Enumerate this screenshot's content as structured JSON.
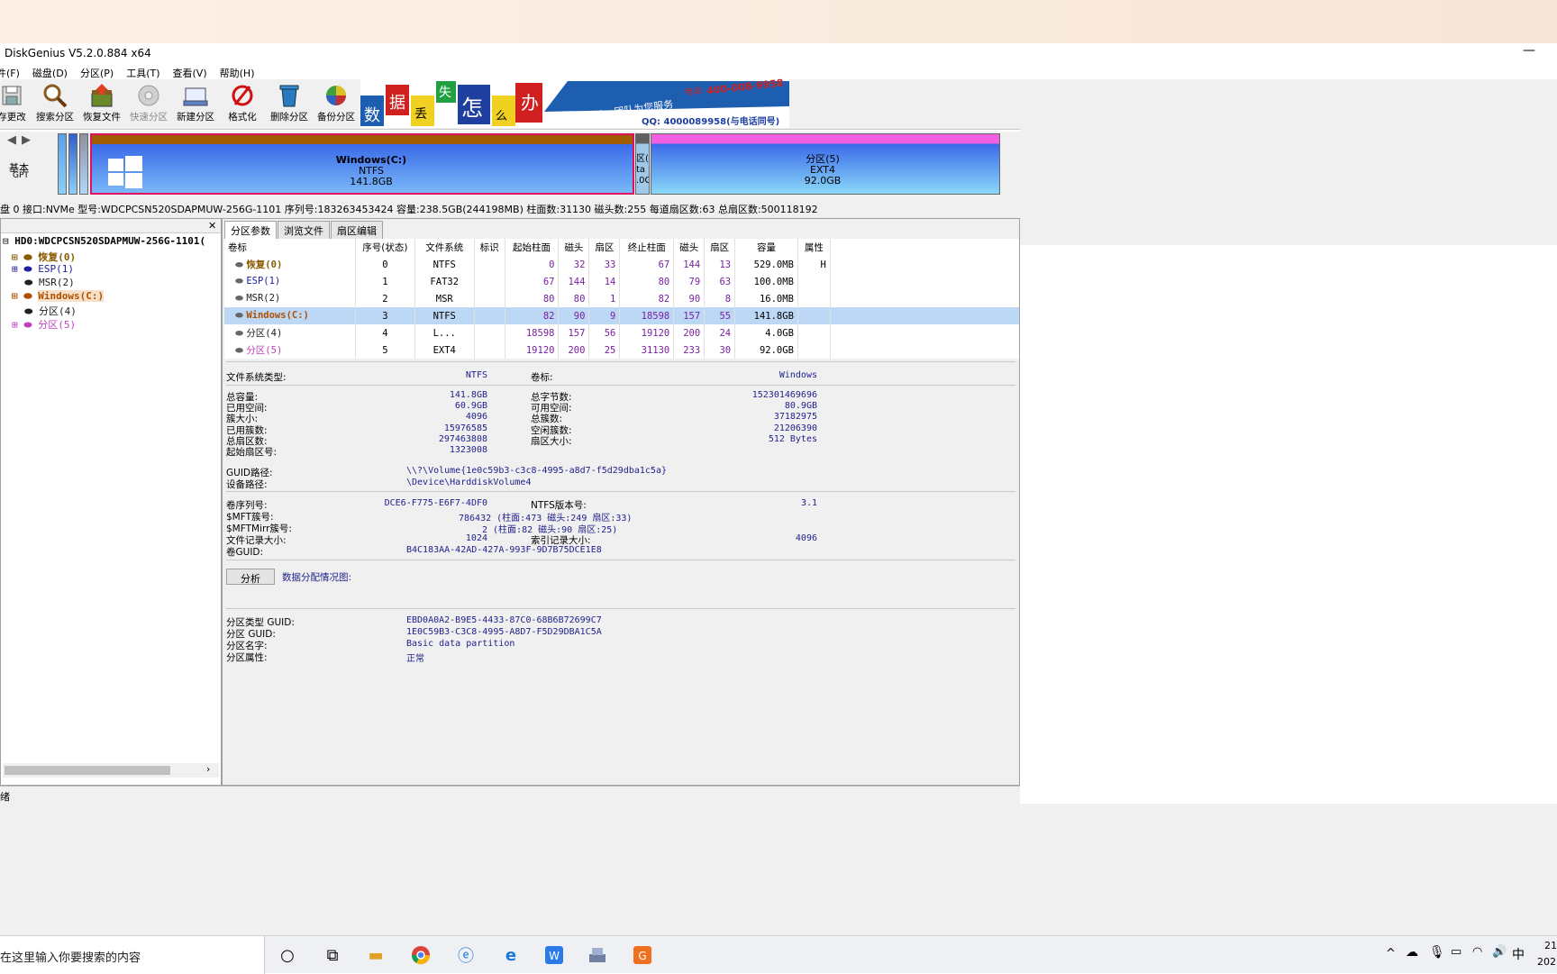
{
  "window": {
    "title": "DiskGenius V5.2.0.884 x64",
    "minimize": "—"
  },
  "menu": [
    "件(F)",
    "磁盘(D)",
    "分区(P)",
    "工具(T)",
    "查看(V)",
    "帮助(H)"
  ],
  "toolbar": [
    {
      "label": "存更改",
      "icon": "save-icon"
    },
    {
      "label": "搜索分区",
      "icon": "search-icon"
    },
    {
      "label": "恢复文件",
      "icon": "restore-icon"
    },
    {
      "label": "快速分区",
      "icon": "quick-partition-icon"
    },
    {
      "label": "新建分区",
      "icon": "new-partition-icon"
    },
    {
      "label": "格式化",
      "icon": "format-icon"
    },
    {
      "label": "删除分区",
      "icon": "delete-icon"
    },
    {
      "label": "备份分区",
      "icon": "backup-icon"
    }
  ],
  "banner": {
    "chars": [
      "数",
      "据",
      "丢",
      "失",
      "怎",
      "么",
      "办"
    ],
    "brand": "DiskGenius团队为您服务",
    "phone": "400-008-9958",
    "qq": "QQ: 4000089958(与电话同号)",
    "phone_prefix": "电话:"
  },
  "diskmap": {
    "nav_label": "基本",
    "nav_sub": "GPT",
    "c_name": "Windows(C:)",
    "c_fs": "NTFS",
    "c_size": "141.8GB",
    "p4_lines": [
      "区(",
      "ta",
      ".0G"
    ],
    "p5_name": "分区(5)",
    "p5_fs": "EXT4",
    "p5_size": "92.0GB"
  },
  "diskinfo": "盘 0 接口:NVMe  型号:WDCPCSN520SDAPMUW-256G-1101  序列号:183263453424  容量:238.5GB(244198MB)  柱面数:31130  磁头数:255  每道扇区数:63  总扇区数:500118192",
  "tree": {
    "root": "HD0:WDCPCSN520SDAPMUW-256G-1101(",
    "items": [
      {
        "label": "恢复(0)",
        "color": "#8a5a00"
      },
      {
        "label": "ESP(1)",
        "color": "#2020a0"
      },
      {
        "label": "MSR(2)",
        "color": "#202020"
      },
      {
        "label": "Windows(C:)",
        "color": "#b05000"
      },
      {
        "label": "分区(4)",
        "color": "#202020"
      },
      {
        "label": "分区(5)",
        "color": "#c040c0"
      }
    ]
  },
  "tabs": [
    "分区参数",
    "浏览文件",
    "扇区编辑"
  ],
  "table": {
    "headers": [
      "卷标",
      "序号(状态)",
      "文件系统",
      "标识",
      "起始柱面",
      "磁头",
      "扇区",
      "终止柱面",
      "磁头",
      "扇区",
      "容量",
      "属性"
    ],
    "rows": [
      {
        "name": "恢复(0)",
        "color": "#8a5a00",
        "cells": [
          "0",
          "NTFS",
          "",
          "0",
          "32",
          "33",
          "67",
          "144",
          "13",
          "529.0MB",
          "H"
        ]
      },
      {
        "name": "ESP(1)",
        "color": "#2020a0",
        "cells": [
          "1",
          "FAT32",
          "",
          "67",
          "144",
          "14",
          "80",
          "79",
          "63",
          "100.0MB",
          ""
        ]
      },
      {
        "name": "MSR(2)",
        "color": "#202020",
        "cells": [
          "2",
          "MSR",
          "",
          "80",
          "80",
          "1",
          "82",
          "90",
          "8",
          "16.0MB",
          ""
        ]
      },
      {
        "name": "Windows(C:)",
        "color": "#b05000",
        "cells": [
          "3",
          "NTFS",
          "",
          "82",
          "90",
          "9",
          "18598",
          "157",
          "55",
          "141.8GB",
          ""
        ]
      },
      {
        "name": "分区(4)",
        "color": "#202020",
        "cells": [
          "4",
          "L...",
          "",
          "18598",
          "157",
          "56",
          "19120",
          "200",
          "24",
          "4.0GB",
          ""
        ]
      },
      {
        "name": "分区(5)",
        "color": "#c040c0",
        "cells": [
          "5",
          "EXT4",
          "",
          "19120",
          "200",
          "25",
          "31130",
          "233",
          "30",
          "92.0GB",
          ""
        ]
      }
    ]
  },
  "fsinfo": {
    "fs_type_label": "文件系统类型:",
    "fs_type": "NTFS",
    "vol_label_label": "卷标:",
    "vol_label": "Windows",
    "left": [
      {
        "k": "总容量:",
        "v": "141.8GB"
      },
      {
        "k": "已用空间:",
        "v": "60.9GB"
      },
      {
        "k": "簇大小:",
        "v": "4096"
      },
      {
        "k": "已用簇数:",
        "v": "15976585"
      },
      {
        "k": "总扇区数:",
        "v": "297463808"
      },
      {
        "k": "起始扇区号:",
        "v": "1323008"
      }
    ],
    "right": [
      {
        "k": "总字节数:",
        "v": "152301469696"
      },
      {
        "k": "可用空间:",
        "v": "80.9GB"
      },
      {
        "k": "总簇数:",
        "v": "37182975"
      },
      {
        "k": "空闲簇数:",
        "v": "21206390"
      },
      {
        "k": "扇区大小:",
        "v": "512 Bytes"
      }
    ],
    "guid_path_label": "GUID路径:",
    "guid_path": "\\\\?\\Volume{1e0c59b3-c3c8-4995-a8d7-f5d29dba1c5a}",
    "device_path_label": "设备路径:",
    "device_path": "\\Device\\HarddiskVolume4",
    "serial_label": "卷序列号:",
    "serial": "DCE6-F775-E6F7-4DF0",
    "ntfs_ver_label": "NTFS版本号:",
    "ntfs_ver": "3.1",
    "mft_label": "$MFT簇号:",
    "mft": "786432 (柱面:473 磁头:249 扇区:33)",
    "mftmirr_label": "$MFTMirr簇号:",
    "mftmirr": "2 (柱面:82 磁头:90 扇区:25)",
    "rec_size_label": "文件记录大小:",
    "rec_size": "1024",
    "idx_size_label": "索引记录大小:",
    "idx_size": "4096",
    "vol_guid_label": "卷GUID:",
    "vol_guid": "B4C183AA-42AD-427A-993F-9D7B75DCE1E8",
    "analyze_button": "分析",
    "alloc_label": "数据分配情况图:",
    "ptype_label": "分区类型 GUID:",
    "ptype": "EBD0A0A2-B9E5-4433-87C0-68B6B72699C7",
    "pguid_label": "分区 GUID:",
    "pguid": "1E0C59B3-C3C8-4995-A8D7-F5D29DBA1C5A",
    "pname_label": "分区名字:",
    "pname": "Basic data partition",
    "pattr_label": "分区属性:",
    "pattr": "正常"
  },
  "status": "绪",
  "taskbar": {
    "search": "在这里输入你要搜索的内容",
    "lang": "中",
    "time": "21",
    "date": "202"
  }
}
